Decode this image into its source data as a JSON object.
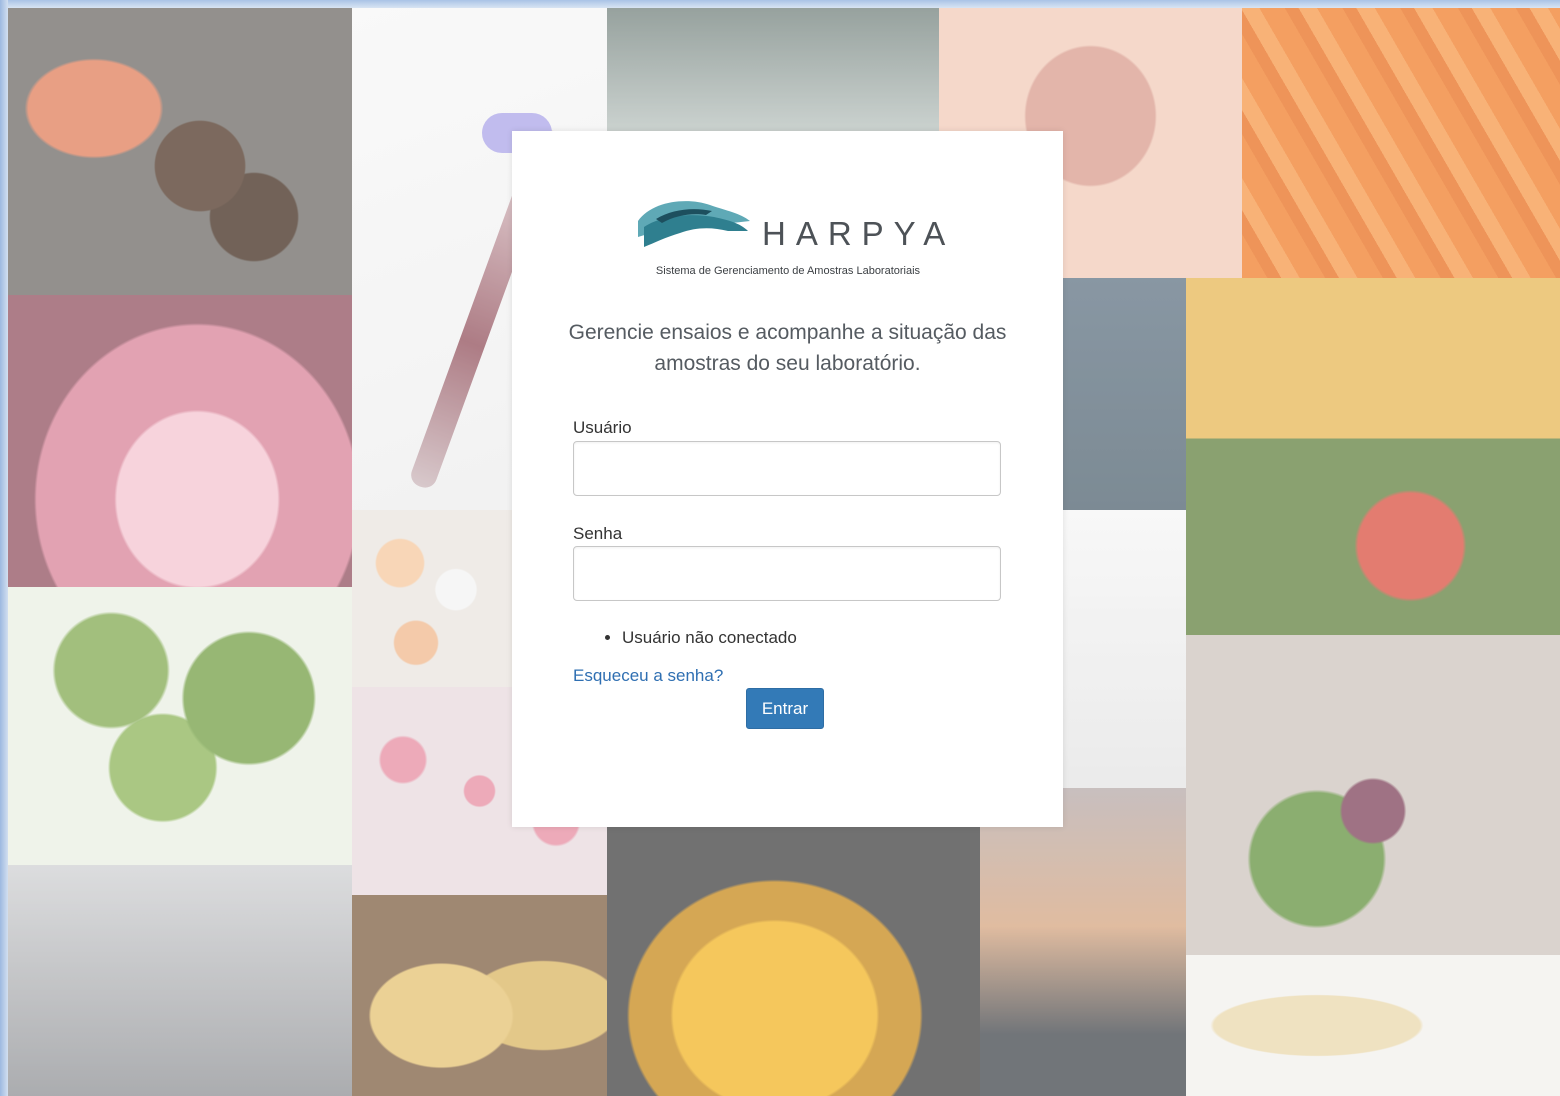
{
  "brand": {
    "name": "HARPYA",
    "subtitle": "Sistema de Gerenciamento de Amostras Laboratoriais",
    "colors": {
      "dark_teal": "#1d4f5e",
      "mid_teal": "#2f7f8f",
      "light_teal": "#5fa9b6"
    }
  },
  "tagline": "Gerencie ensaios e acompanhe a situação das amostras do seu laboratório.",
  "form": {
    "username_label": "Usuário",
    "username_value": "",
    "password_label": "Senha",
    "password_value": "",
    "status_messages": [
      "Usuário não conectado"
    ],
    "forgot_password_link": "Esqueceu a senha?",
    "submit_label": "Entrar"
  },
  "colors": {
    "primary_button": "#337ab7",
    "link": "#2f6fb2",
    "text": "#333333"
  }
}
